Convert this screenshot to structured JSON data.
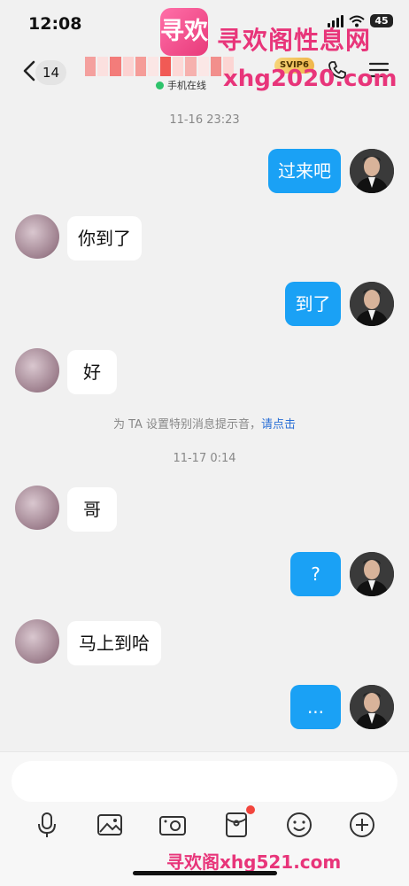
{
  "status_bar": {
    "time": "12:08",
    "battery": "45"
  },
  "watermark": {
    "logo": "寻欢",
    "title": "寻欢阁性息网",
    "url": "xhg2020.com",
    "bottom": "寻欢阁xhg521.com"
  },
  "nav": {
    "unread_count": "14",
    "svip": "SVIP6",
    "status": "手机在线",
    "icons": {
      "back": "chevron-left-icon",
      "call": "phone-icon",
      "menu": "menu-icon"
    }
  },
  "chat": {
    "timestamps": [
      "11-16 23:23",
      "11-17 0:14"
    ],
    "system_notice": {
      "text": "为 TA 设置特别消息提示音，",
      "link": "请点击"
    },
    "messages": [
      {
        "from": "self",
        "text": "过来吧"
      },
      {
        "from": "other",
        "text": "你到了"
      },
      {
        "from": "self",
        "text": "到了"
      },
      {
        "from": "other",
        "text": "好"
      },
      {
        "from": "other",
        "text": "哥"
      },
      {
        "from": "self",
        "text": "?"
      },
      {
        "from": "other",
        "text": "马上到哈"
      },
      {
        "from": "self",
        "text": "..."
      }
    ]
  },
  "input": {
    "value": "",
    "placeholder": ""
  },
  "toolbar": {
    "icons": [
      "microphone-icon",
      "image-icon",
      "camera-icon",
      "red-packet-icon",
      "emoji-icon",
      "plus-icon"
    ]
  },
  "colors": {
    "self_bubble": "#1aa1f5",
    "watermark": "#e8357a",
    "online": "#2dc36b"
  }
}
